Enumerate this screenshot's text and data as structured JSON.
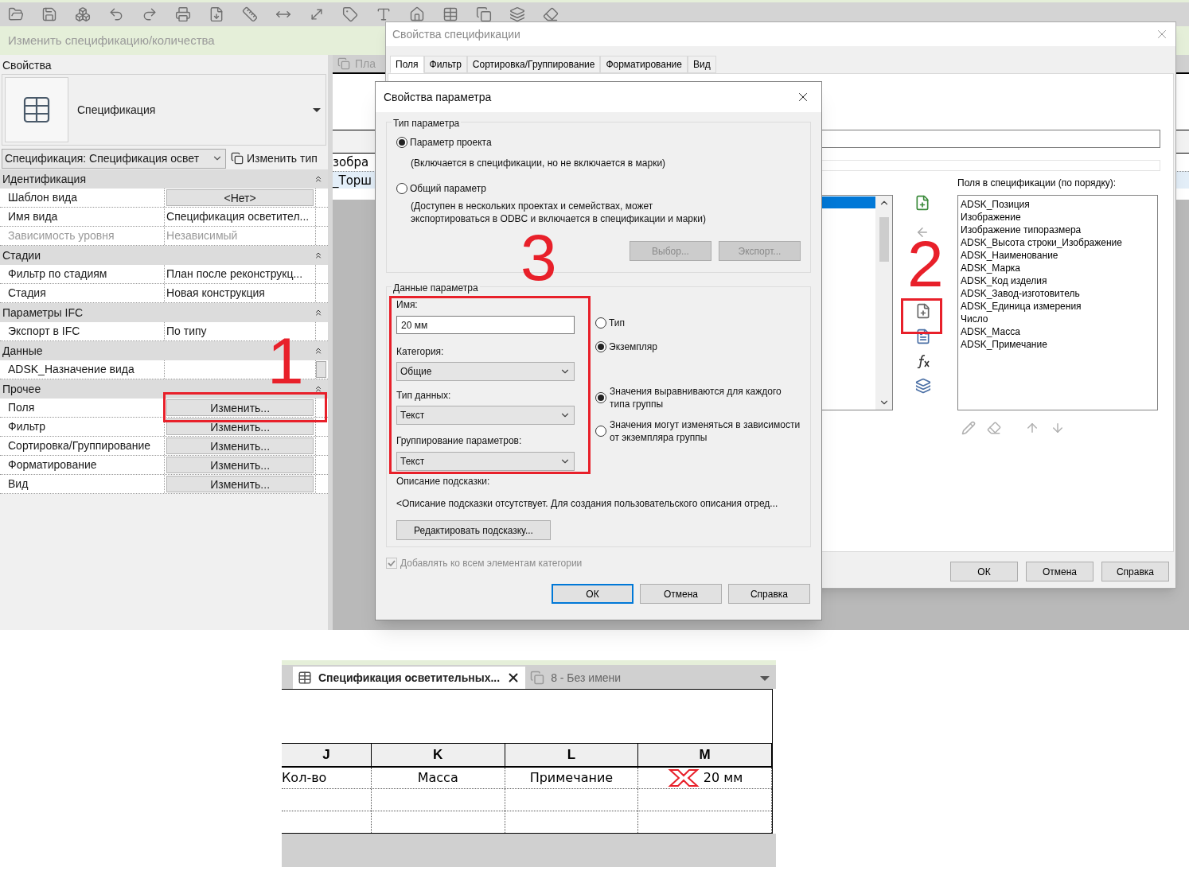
{
  "ribbon": {
    "title": "Изменить спецификацию/количества"
  },
  "properties": {
    "title": "Свойства",
    "type_name": "Спецификация",
    "type_selector": "Спецификация: Спецификация освет",
    "edit_type": "Изменить тип",
    "groups": [
      {
        "name": "Идентификация",
        "rows": [
          {
            "label": "Шаблон вида",
            "value": "<Нет>",
            "kind": "button",
            "disabled": false
          },
          {
            "label": "Имя вида",
            "value": "Спецификация осветител...",
            "kind": "text",
            "disabled": false
          },
          {
            "label": "Зависимость уровня",
            "value": "Независимый",
            "kind": "text",
            "disabled": true
          }
        ]
      },
      {
        "name": "Стадии",
        "rows": [
          {
            "label": "Фильтр по стадиям",
            "value": "План после реконструкц...",
            "kind": "text",
            "disabled": false
          },
          {
            "label": "Стадия",
            "value": "Новая конструкция",
            "kind": "text",
            "disabled": false
          }
        ]
      },
      {
        "name": "Параметры IFC",
        "rows": [
          {
            "label": "Экспорт в IFC",
            "value": "По типу",
            "kind": "text",
            "disabled": false
          }
        ]
      },
      {
        "name": "Данные",
        "rows": [
          {
            "label": "ADSK_Назначение вида",
            "kind": "field",
            "disabled": false
          }
        ]
      },
      {
        "name": "Прочее",
        "rows": [
          {
            "label": "Поля",
            "value": "Изменить...",
            "kind": "button",
            "disabled": false
          },
          {
            "label": "Фильтр",
            "value": "Изменить...",
            "kind": "button",
            "disabled": false
          },
          {
            "label": "Сортировка/Группирование",
            "value": "Изменить...",
            "kind": "button",
            "disabled": false
          },
          {
            "label": "Форматирование",
            "value": "Изменить...",
            "kind": "button",
            "disabled": false
          },
          {
            "label": "Вид",
            "value": "Изменить...",
            "kind": "button",
            "disabled": false
          }
        ]
      }
    ]
  },
  "view": {
    "tab": "Пла",
    "cells": [
      "зобра",
      "_Торш"
    ]
  },
  "schedule_dialog": {
    "title": "Свойства спецификации",
    "tabs": [
      {
        "label": "Поля",
        "selected": true
      },
      {
        "label": "Фильтр",
        "selected": false
      },
      {
        "label": "Сортировка/Группирование",
        "selected": false
      },
      {
        "label": "Форматирование",
        "selected": false
      },
      {
        "label": "Вид",
        "selected": false
      }
    ],
    "fields_label": "Поля в спецификации (по порядку):",
    "fields": [
      "ADSK_Позиция",
      "Изображение",
      "Изображение типоразмера",
      "ADSK_Высота строки_Изображение",
      "ADSK_Наименование",
      "ADSK_Марка",
      "ADSK_Код изделия",
      "ADSK_Завод-изготовитель",
      "ADSK_Единица измерения",
      "Число",
      "ADSK_Масса",
      "ADSK_Примечание"
    ],
    "buttons": [
      "ОК",
      "Отмена",
      "Справка"
    ]
  },
  "parameter_dialog": {
    "title": "Свойства параметра",
    "type_group": {
      "title": "Тип параметра",
      "options": [
        {
          "label": "Параметр проекта",
          "note": "(Включается в спецификации, но не включается в марки)",
          "selected": true
        },
        {
          "label": "Общий параметр",
          "note": "(Доступен в нескольких проектах и семействах, может экспортироваться в ODBC и включается в спецификации и марки)",
          "selected": false
        }
      ],
      "buttons": [
        {
          "label": "Выбор...",
          "disabled": true
        },
        {
          "label": "Экспорт...",
          "disabled": true
        }
      ]
    },
    "data_group": {
      "title": "Данные параметра",
      "name_label": "Имя:",
      "name_value": "20 мм",
      "category_label": "Категория:",
      "category_value": "Общие",
      "data_type_label": "Тип данных:",
      "data_type_value": "Текст",
      "grouping_label": "Группирование параметров:",
      "grouping_value": "Текст",
      "scope_options": [
        {
          "label": "Тип",
          "selected": false
        },
        {
          "label": "Экземпляр",
          "selected": true
        }
      ],
      "group_options": [
        {
          "label": "Значения выравниваются для каждого типа группы",
          "selected": true
        },
        {
          "label": "Значения могут изменяться в зависимости от экземпляра группы",
          "selected": false
        }
      ],
      "tooltip_label": "Описание подсказки:",
      "tooltip_text": "<Описание подсказки отсутствует. Для создания пользовательского описания отред...",
      "edit_tooltip": "Редактировать подсказку..."
    },
    "add_to_all": {
      "label": "Добавлять ко всем элементам категории",
      "checked": true,
      "disabled": true
    },
    "buttons": [
      "ОК",
      "Отмена",
      "Справка"
    ]
  },
  "annotations": [
    {
      "label": "1"
    },
    {
      "label": "2"
    },
    {
      "label": "3"
    }
  ],
  "schedule_view": {
    "tabs": [
      {
        "label": "Спецификация осветительных...",
        "selected": true
      },
      {
        "label": "8 - Без имени",
        "selected": false
      }
    ],
    "columns": [
      "J",
      "K",
      "L",
      "M"
    ],
    "rows": [
      {
        "cells": [
          {
            "text": "Кол-во",
            "error": false
          },
          {
            "text": "Масса",
            "error": false
          },
          {
            "text": "Примечание",
            "error": false
          },
          {
            "text": "20 мм",
            "error": true
          }
        ]
      }
    ]
  }
}
